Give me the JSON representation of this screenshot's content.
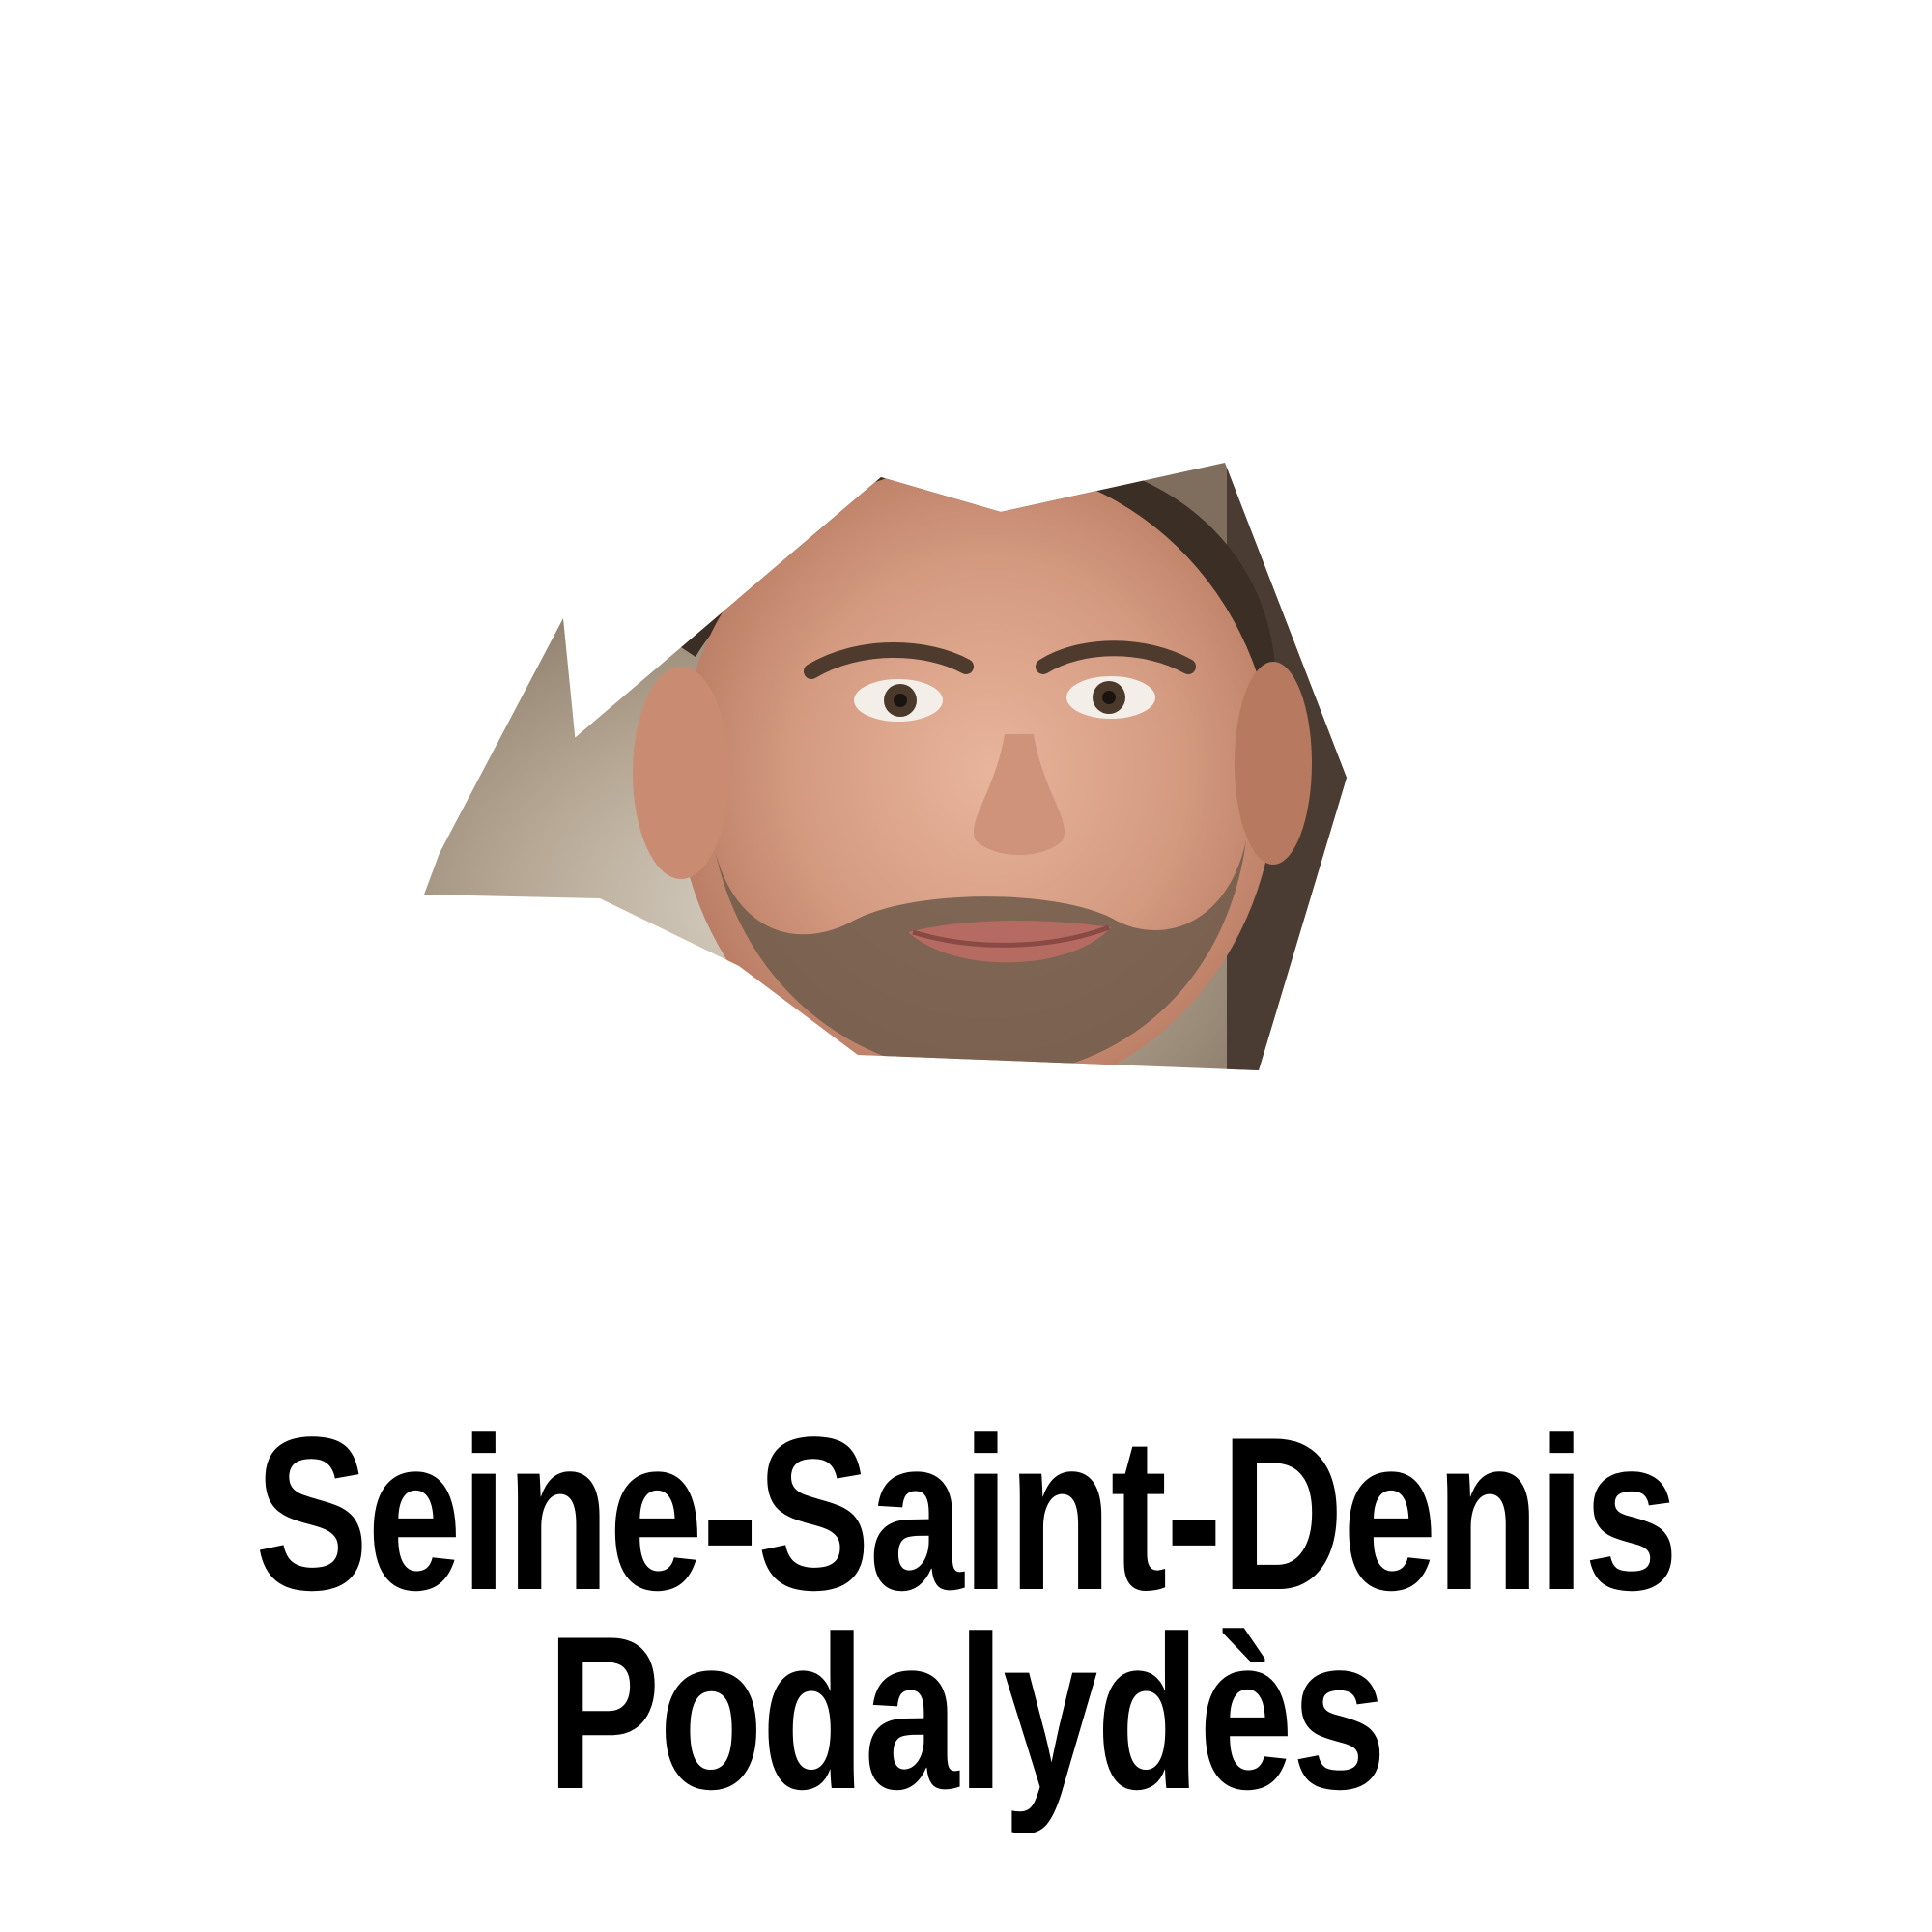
{
  "caption": {
    "line1": "Seine-Saint-Denis",
    "line2": "Podalydès"
  },
  "colors": {
    "background": "#ffffff",
    "text": "#000000",
    "skin": "#d9a38a",
    "hair": "#3b2e25",
    "beard": "#6e5a4a"
  }
}
